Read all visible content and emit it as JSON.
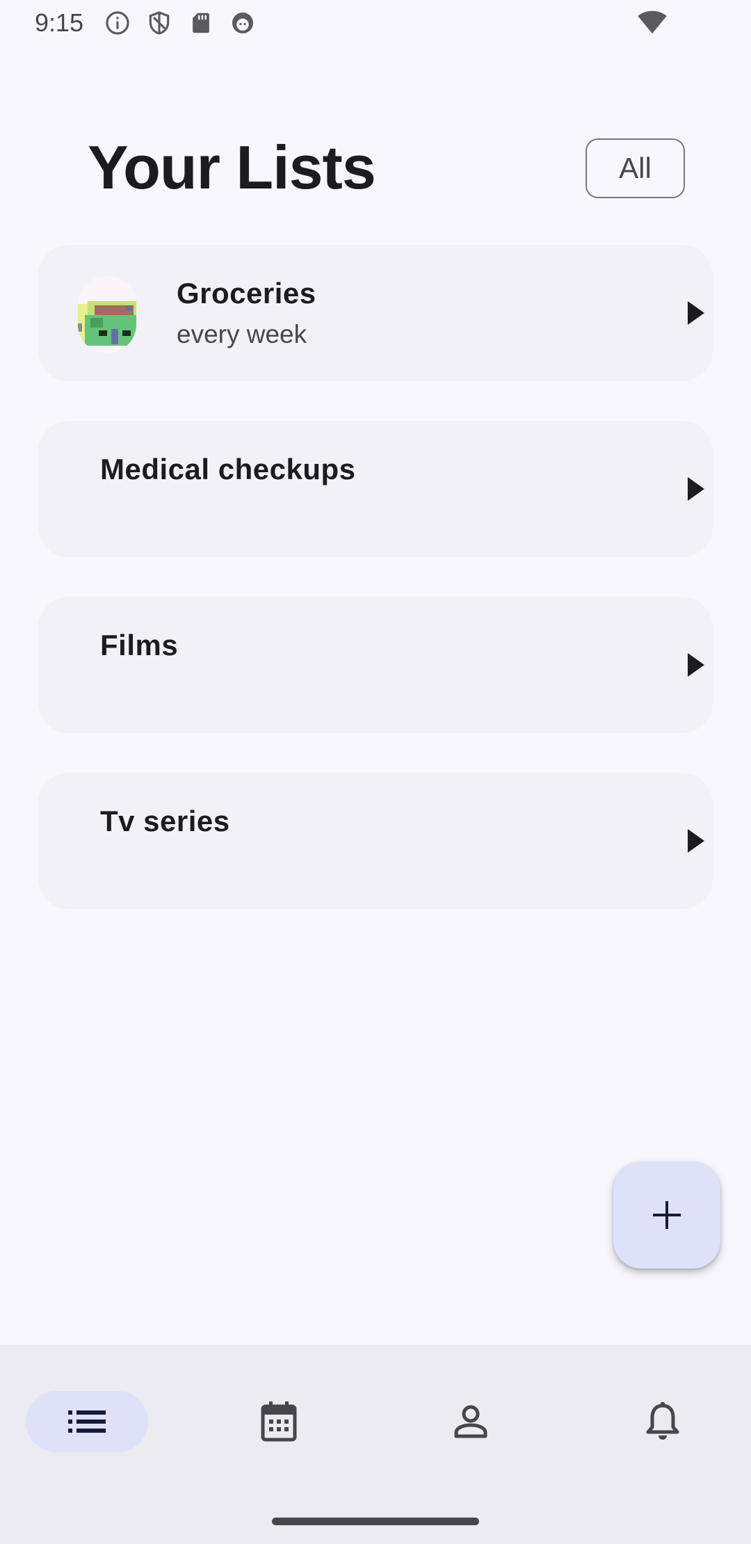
{
  "status_bar": {
    "time": "9:15",
    "icons": [
      "info-icon",
      "shield-icon",
      "sd-card-icon",
      "android-icon"
    ],
    "wifi_icon": "wifi-icon"
  },
  "header": {
    "title": "Your Lists",
    "filter_label": "All"
  },
  "lists": [
    {
      "title": "Groceries",
      "subtitle": "every week",
      "has_thumbnail": true
    },
    {
      "title": "Medical checkups",
      "subtitle": ""
    },
    {
      "title": "Films",
      "subtitle": ""
    },
    {
      "title": "Tv series",
      "subtitle": ""
    }
  ],
  "fab": {
    "icon": "plus-icon"
  },
  "bottom_nav": {
    "items": [
      {
        "name": "lists",
        "icon": "list-icon",
        "active": true
      },
      {
        "name": "calendar",
        "icon": "calendar-icon",
        "active": false
      },
      {
        "name": "profile",
        "icon": "person-icon",
        "active": false
      },
      {
        "name": "notifications",
        "icon": "bell-icon",
        "active": false
      }
    ]
  },
  "colors": {
    "background": "#f8f7fd",
    "card": "#f2f1f7",
    "accent_container": "#dfe1f9",
    "nav_background": "#ecebf2",
    "text_primary": "#1b1b21",
    "text_secondary": "#47464f"
  }
}
